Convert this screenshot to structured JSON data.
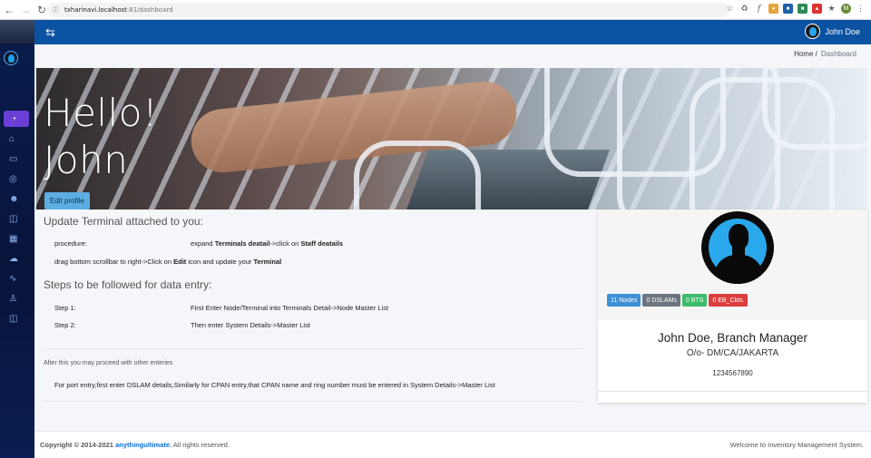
{
  "browser": {
    "url_host": "txharinavi.localhost",
    "url_path": ":81/dashboard",
    "avatar_letter": "M"
  },
  "header": {
    "user_name": "John Doe"
  },
  "breadcrumb": {
    "home": "Home /",
    "current": "Dashboard"
  },
  "hero": {
    "line1": "Hello!",
    "line2": "John",
    "edit_label": "Edit profile"
  },
  "terminal_section": {
    "title": "Update Terminal attached to you:",
    "procedure_label": "procedure:",
    "procedure_pre": "expand ",
    "procedure_b1": "Terminals deatail",
    "procedure_mid": "->click on ",
    "procedure_b2": "Staff deatails",
    "drag_pre": "drag bottom scrollbar to right->Click on ",
    "drag_b1": "Edit",
    "drag_mid": " icon and update your ",
    "drag_b2": "Terminal"
  },
  "steps_section": {
    "title": "Steps to be followed for data entry:",
    "steps": [
      {
        "label": "Step 1:",
        "text": "First Enter Node/Terminal into Terminals Detail->Node Master List"
      },
      {
        "label": "Step 2:",
        "text": "Then enter System Details->Master List"
      }
    ]
  },
  "after_section": {
    "note": "After this you may proceed with other enteries",
    "detail": "For port entry,first enter DSLAM details,Similarly for CPAN entry,that CPAN name and ring number must be entered in System Details->Master List"
  },
  "profile": {
    "name_title": "John Doe, Branch Manager",
    "org": "O/o- DM/CA/JAKARTA",
    "phone": "1234567890",
    "badges": [
      {
        "label": "11 Nodes",
        "color": "#3d8fd6"
      },
      {
        "label": "0 DSLAMs",
        "color": "#6c757d"
      },
      {
        "label": "0 BTS",
        "color": "#3dbb6b"
      },
      {
        "label": "0 EB_Ckts.",
        "color": "#dc3d3d"
      }
    ]
  },
  "footer": {
    "copyright_pre": "Copyright © 2014-2021 ",
    "brand": "anythingultimate.",
    "rights": " All rights reserved.",
    "welcome": "Welcome to Inventory Management System."
  }
}
